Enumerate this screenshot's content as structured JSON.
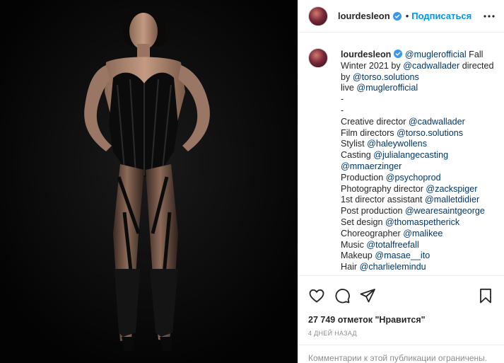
{
  "post": {
    "username": "lourdesleon",
    "follow_label": "Подписаться",
    "separator": "•",
    "caption_lines": [
      {
        "parts": [
          {
            "t": "@muglerofficial",
            "m": true
          },
          {
            "t": " Fall",
            "m": false
          }
        ]
      },
      {
        "parts": [
          {
            "t": "Winter 2021 by ",
            "m": false
          },
          {
            "t": "@cadwallader",
            "m": true
          },
          {
            "t": " directed",
            "m": false
          }
        ]
      },
      {
        "parts": [
          {
            "t": "by ",
            "m": false
          },
          {
            "t": "@torso.solutions",
            "m": true
          }
        ]
      },
      {
        "parts": [
          {
            "t": "live ",
            "m": false
          },
          {
            "t": "@muglerofficial",
            "m": true
          }
        ]
      },
      {
        "parts": [
          {
            "t": "-",
            "m": false
          }
        ]
      },
      {
        "parts": [
          {
            "t": "-",
            "m": false
          }
        ]
      },
      {
        "parts": [
          {
            "t": "Creative director ",
            "m": false
          },
          {
            "t": "@cadwallader",
            "m": true
          }
        ]
      },
      {
        "parts": [
          {
            "t": "Film directors ",
            "m": false
          },
          {
            "t": "@torso.solutions",
            "m": true
          }
        ]
      },
      {
        "parts": [
          {
            "t": "Stylist ",
            "m": false
          },
          {
            "t": "@haleywollens",
            "m": true
          }
        ]
      },
      {
        "parts": [
          {
            "t": "Casting ",
            "m": false
          },
          {
            "t": "@julialangecasting",
            "m": true
          }
        ]
      },
      {
        "parts": [
          {
            "t": "@mmaerzinger",
            "m": true
          }
        ]
      },
      {
        "parts": [
          {
            "t": "Production ",
            "m": false
          },
          {
            "t": "@psychoprod",
            "m": true
          }
        ]
      },
      {
        "parts": [
          {
            "t": "Photography director ",
            "m": false
          },
          {
            "t": "@zackspiger",
            "m": true
          }
        ]
      },
      {
        "parts": [
          {
            "t": "1st director assistant ",
            "m": false
          },
          {
            "t": "@malletdidier",
            "m": true
          }
        ]
      },
      {
        "parts": [
          {
            "t": "Post production ",
            "m": false
          },
          {
            "t": "@wearesaintgeorge",
            "m": true
          }
        ]
      },
      {
        "parts": [
          {
            "t": "Set design ",
            "m": false
          },
          {
            "t": "@thomaspetherick",
            "m": true
          }
        ]
      },
      {
        "parts": [
          {
            "t": "Choreographer ",
            "m": false
          },
          {
            "t": "@malikee",
            "m": true
          }
        ]
      },
      {
        "parts": [
          {
            "t": "Music ",
            "m": false
          },
          {
            "t": "@totalfreefall",
            "m": true
          }
        ]
      },
      {
        "parts": [
          {
            "t": "Makeup ",
            "m": false
          },
          {
            "t": "@masae__ito",
            "m": true
          }
        ]
      },
      {
        "parts": [
          {
            "t": "Hair ",
            "m": false
          },
          {
            "t": "@charlielemindu",
            "m": true
          }
        ]
      }
    ],
    "likes_text": "27 749 отметок \"Нравится\"",
    "date_text": "4 ДНЕЙ НАЗАД",
    "comments_text": "Комментарии к этой публикации ограничены."
  },
  "icons": {
    "verified": "verified-badge-icon",
    "more": "more-options-icon",
    "like": "heart-icon",
    "comment": "comment-bubble-icon",
    "share": "paper-plane-icon",
    "save": "bookmark-icon"
  },
  "colors": {
    "accent": "#0095f6",
    "mention": "#00376b",
    "photo_bg": "#050505"
  }
}
